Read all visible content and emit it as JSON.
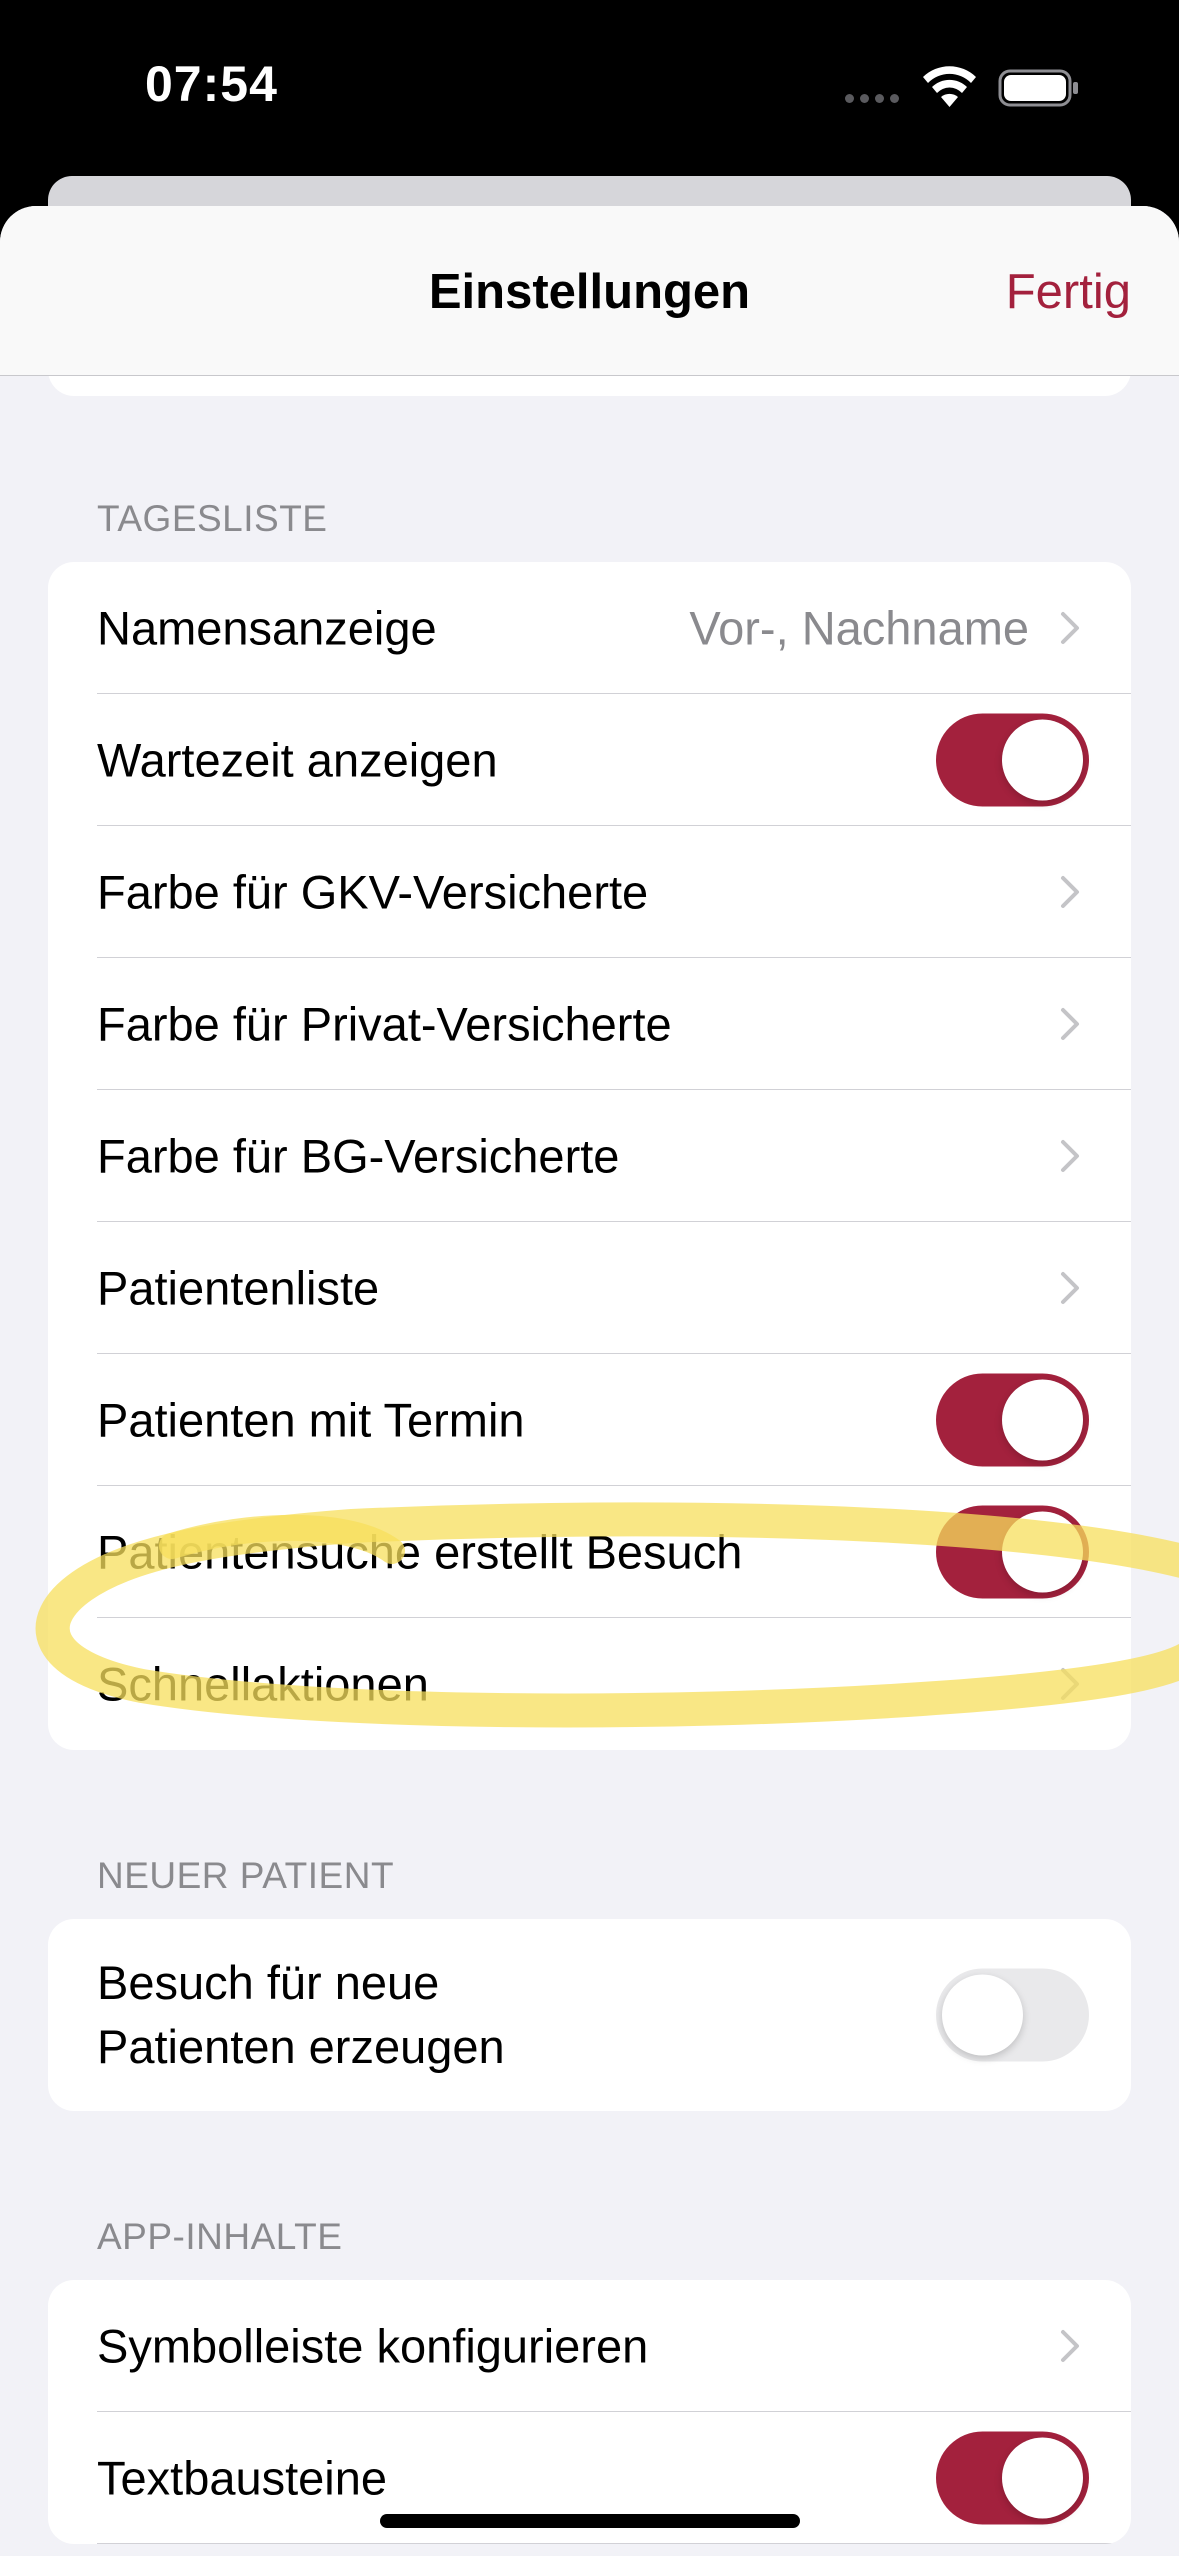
{
  "status_bar": {
    "time": "07:54",
    "icons": [
      "cellular-signal-icon",
      "wifi-icon",
      "battery-icon"
    ]
  },
  "nav": {
    "title": "Einstellungen",
    "done_label": "Fertig"
  },
  "colors": {
    "accent": "#a3213d",
    "background": "#f2f2f7",
    "highlight": "#f7df5c"
  },
  "sections": {
    "tagesliste": {
      "header": "TAGESLISTE",
      "rows": [
        {
          "label": "Namensanzeige",
          "value": "Vor-, Nachname",
          "control": "chevron"
        },
        {
          "label": "Wartezeit anzeigen",
          "control": "toggle",
          "on": true
        },
        {
          "label": "Farbe für GKV-Versicherte",
          "control": "chevron"
        },
        {
          "label": "Farbe für Privat-Versicherte",
          "control": "chevron"
        },
        {
          "label": "Farbe für BG-Versicherte",
          "control": "chevron"
        },
        {
          "label": "Patientenliste",
          "control": "chevron"
        },
        {
          "label": "Patienten mit Termin",
          "control": "toggle",
          "on": true
        },
        {
          "label": "Patientensuche erstellt Besuch",
          "control": "toggle",
          "on": true
        },
        {
          "label": "Schnellaktionen",
          "control": "chevron"
        }
      ]
    },
    "neuer_patient": {
      "header": "NEUER PATIENT",
      "rows": [
        {
          "label": "Besuch für neue\nPatienten erzeugen",
          "control": "toggle",
          "on": false
        }
      ]
    },
    "app_inhalte": {
      "header": "APP-INHALTE",
      "rows": [
        {
          "label": "Symbolleiste konfigurieren",
          "control": "chevron"
        },
        {
          "label": "Textbausteine",
          "control": "toggle",
          "on": true
        }
      ]
    }
  }
}
